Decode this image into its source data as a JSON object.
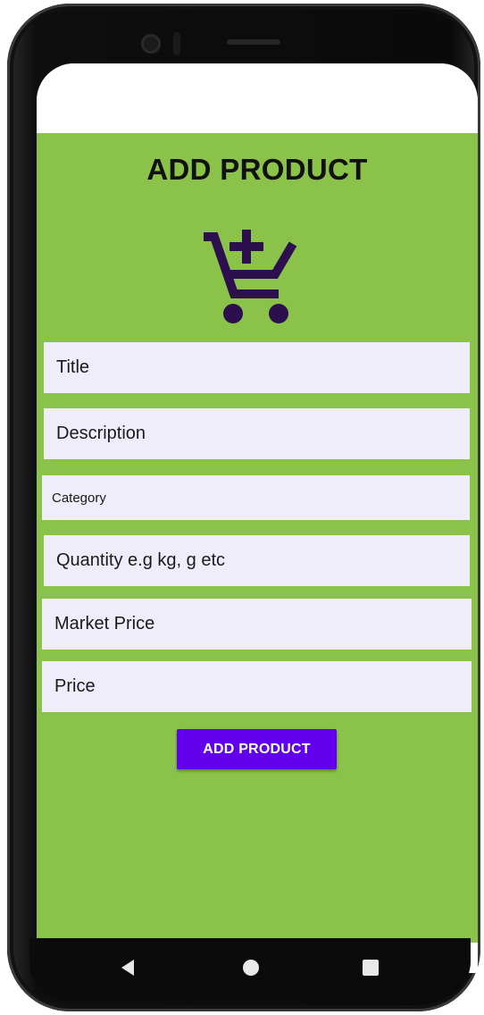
{
  "page": {
    "title": "ADD PRODUCT"
  },
  "icons": {
    "cart": "add-shopping-cart-icon",
    "cart_color": "#2d0f4f"
  },
  "form": {
    "fields": [
      {
        "name": "title",
        "placeholder": "Title"
      },
      {
        "name": "description",
        "placeholder": "Description"
      },
      {
        "name": "category",
        "placeholder": "Category"
      },
      {
        "name": "quantity",
        "placeholder": "Quantity e.g kg, g etc"
      },
      {
        "name": "market-price",
        "placeholder": "Market Price"
      },
      {
        "name": "price",
        "placeholder": "Price"
      }
    ],
    "submit_label": "ADD PRODUCT"
  },
  "colors": {
    "background": "#8bc34a",
    "field_background": "#eeedf9",
    "button": "#6200ee"
  },
  "navigation": {
    "back_icon": "back-triangle-icon",
    "home_icon": "home-circle-icon",
    "recents_icon": "recents-square-icon"
  }
}
